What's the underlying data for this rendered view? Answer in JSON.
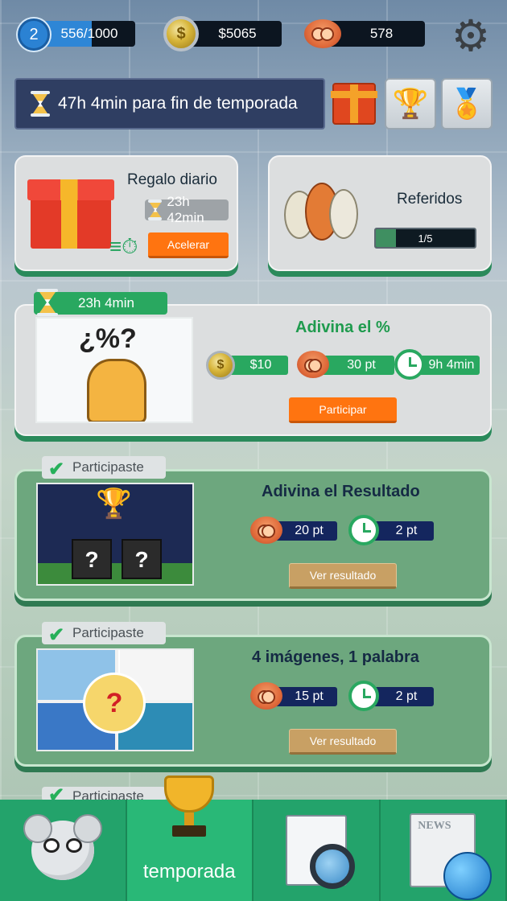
{
  "top_bar": {
    "level": "2",
    "xp": "556/1000",
    "xp_progress": 0.556,
    "coins": "$5065",
    "points": "578",
    "icons": [
      "level-badge-icon",
      "coin-icon",
      "monkey-token-icon",
      "gear-icon"
    ]
  },
  "season": {
    "text": "47h 4min para fin de temporada",
    "buttons": [
      "gift-icon",
      "trophy-icon",
      "medal-icon"
    ]
  },
  "daily_gift": {
    "title": "Regalo diario",
    "timer": "23h 42min",
    "button": "Acelerar"
  },
  "referrals": {
    "title": "Referidos",
    "progress": "1/5",
    "progress_value": 0.2
  },
  "games": [
    {
      "tag": "23h 4min",
      "title": "Adivina el %",
      "image_text": "¿%?",
      "chips": [
        "$10",
        "30 pt",
        "9h 4min"
      ],
      "button": "Participar"
    },
    {
      "tag": "Participaste",
      "title": "Adivina el Resultado",
      "chips": [
        "20 pt",
        "2 pt"
      ],
      "button": "Ver resultado"
    },
    {
      "tag": "Participaste",
      "title": "4 imágenes, 1 palabra",
      "chips": [
        "15 pt",
        "2 pt"
      ],
      "button": "Ver resultado"
    },
    {
      "tag": "Participaste"
    }
  ],
  "bottom_nav": {
    "items": [
      "profile",
      "temporada",
      "quiz",
      "news"
    ],
    "active_label": "temporada",
    "news_text": "NEWS"
  },
  "colors": {
    "accent_green": "#29a860",
    "orange": "#ff7410",
    "navy": "#14265e",
    "nav_bg": "#23a36b"
  }
}
